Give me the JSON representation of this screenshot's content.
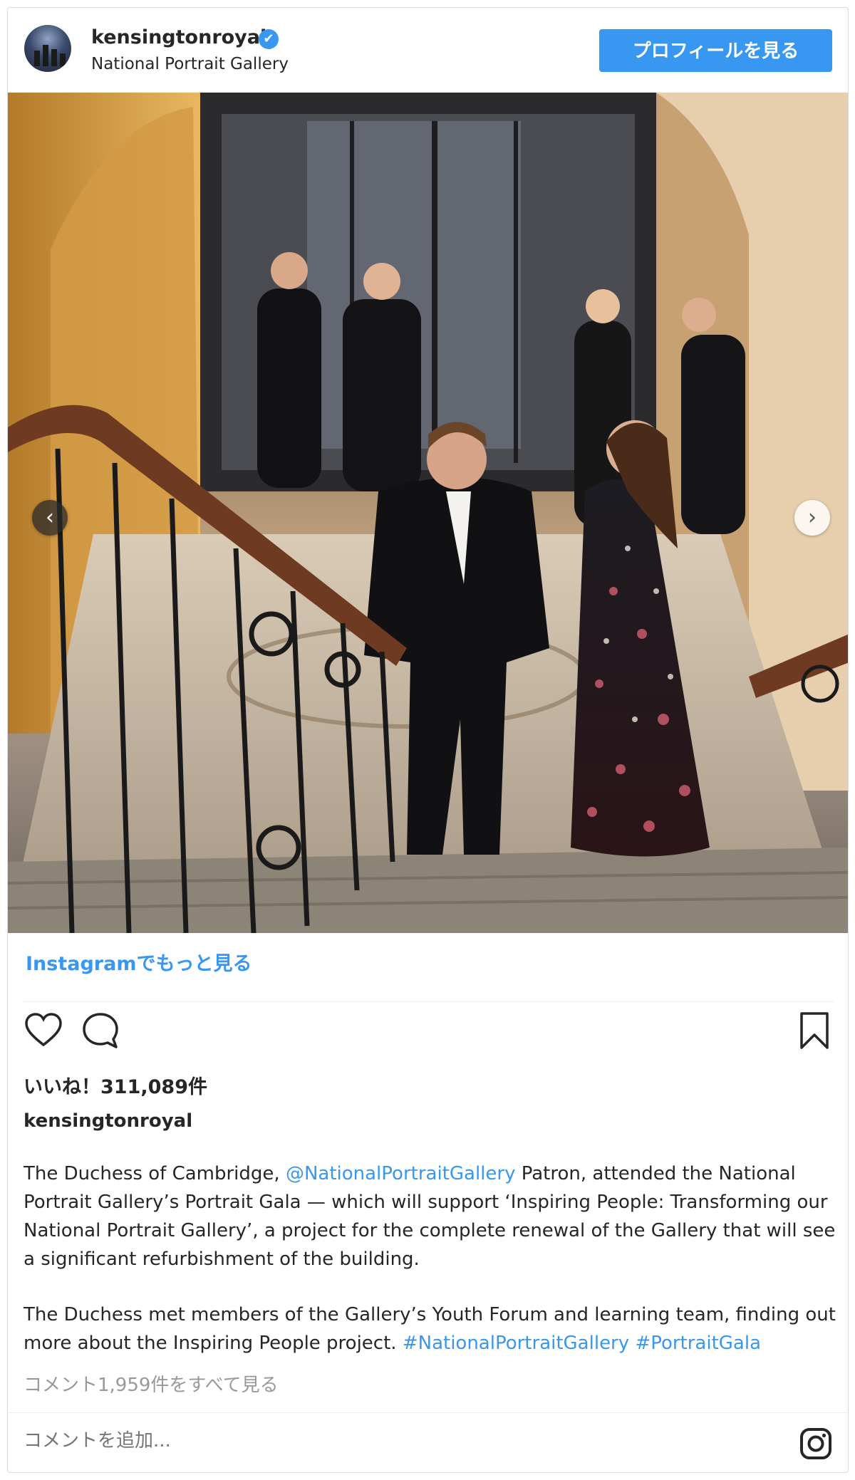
{
  "header": {
    "username": "kensingtonroyal",
    "verified_glyph": "✔",
    "location": "National Portrait Gallery",
    "profile_button": "プロフィールを見る"
  },
  "post": {
    "image_alt": "",
    "carousel": {
      "prev_glyph": "‹",
      "next_glyph": "›"
    }
  },
  "more_on_instagram": "Instagramでもっと見る",
  "likes": "いいね！311,089件",
  "caption": {
    "username": "kensingtonroyal",
    "p1_before": "The Duchess of Cambridge, ",
    "p1_mention": "@NationalPortraitGallery",
    "p1_after": " Patron, attended the National Portrait Gallery’s Portrait Gala — which will support ‘Inspiring People: Transforming our National Portrait Gallery’, a project for the complete renewal of the Gallery that will see a significant refurbishment of the building.",
    "p2_before": "The Duchess met members of the Gallery’s Youth Forum and learning team, finding out more about the Inspiring People project. ",
    "p2_tag1": "#NationalPortraitGallery",
    "p2_tag2": "#PortraitGala"
  },
  "view_comments": "コメント1,959件をすべて見る",
  "comment_placeholder": "コメントを追加...",
  "icons": {
    "verified": "verified-badge-icon",
    "like": "heart-icon",
    "comment": "comment-bubble-icon",
    "save": "bookmark-icon",
    "instagram": "instagram-logo-icon"
  },
  "colors": {
    "accent": "#3897f0",
    "text": "#262626",
    "muted": "#999999",
    "border": "#dbdbdb"
  }
}
